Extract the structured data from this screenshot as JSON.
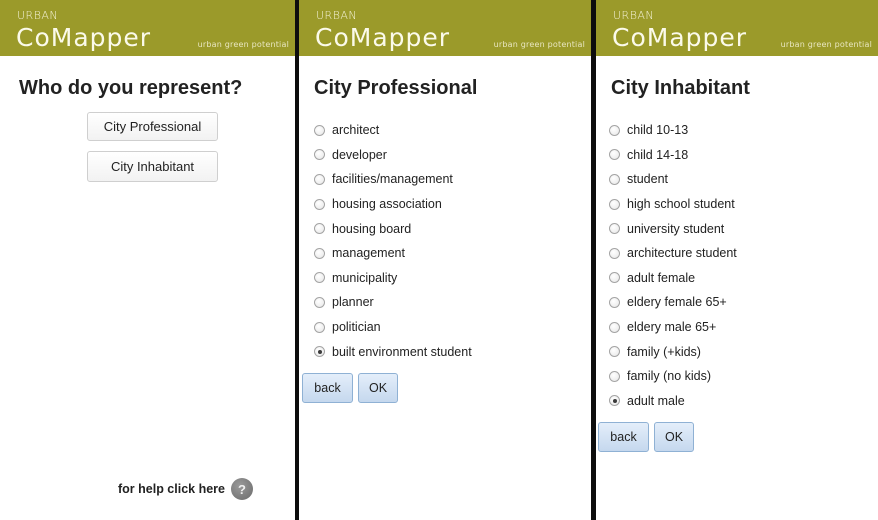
{
  "brand": {
    "small": "URBAN",
    "name": "CoMapper",
    "tagline": "urban green potential",
    "header_color": "#9b9a2a"
  },
  "screen1": {
    "title": "Who do you represent?",
    "options": [
      "City Professional",
      "City Inhabitant"
    ],
    "help_text": "for help click here",
    "help_icon": "question-mark-icon"
  },
  "screen2": {
    "title": "City Professional",
    "options": [
      {
        "label": "architect",
        "checked": false
      },
      {
        "label": "developer",
        "checked": false
      },
      {
        "label": "facilities/management",
        "checked": false
      },
      {
        "label": "housing association",
        "checked": false
      },
      {
        "label": "housing board",
        "checked": false
      },
      {
        "label": "management",
        "checked": false
      },
      {
        "label": "municipality",
        "checked": false
      },
      {
        "label": "planner",
        "checked": false
      },
      {
        "label": "politician",
        "checked": false
      },
      {
        "label": "built environment student",
        "checked": true
      }
    ],
    "back_label": "back",
    "ok_label": "OK"
  },
  "screen3": {
    "title": "City Inhabitant",
    "options": [
      {
        "label": "child 10-13",
        "checked": false
      },
      {
        "label": "child 14-18",
        "checked": false
      },
      {
        "label": "student",
        "checked": false
      },
      {
        "label": "high school student",
        "checked": false
      },
      {
        "label": "university student",
        "checked": false
      },
      {
        "label": "architecture student",
        "checked": false
      },
      {
        "label": "adult female",
        "checked": false
      },
      {
        "label": "eldery female 65+",
        "checked": false
      },
      {
        "label": "eldery male 65+",
        "checked": false
      },
      {
        "label": "family (+kids)",
        "checked": false
      },
      {
        "label": "family (no kids)",
        "checked": false
      },
      {
        "label": "adult male",
        "checked": true
      }
    ],
    "back_label": "back",
    "ok_label": "OK"
  }
}
